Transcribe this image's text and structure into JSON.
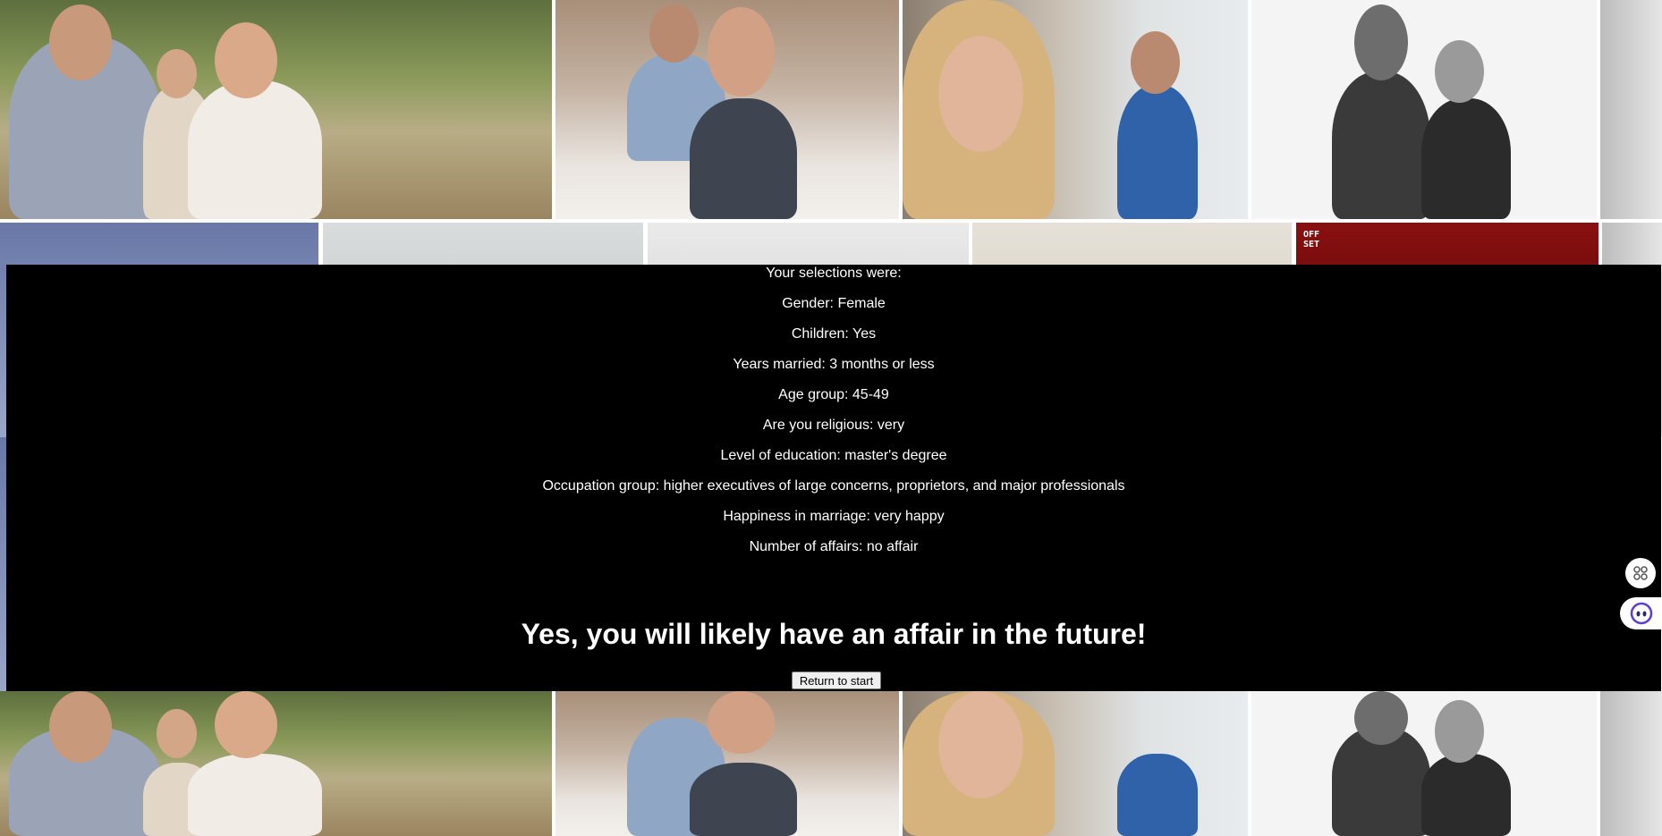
{
  "selections": {
    "heading": "Your selections were:",
    "gender": "Gender: Female",
    "children": "Children: Yes",
    "years_married": "Years married: 3 months or less",
    "age_group": "Age group: 45-49",
    "religious": "Are you religious: very",
    "education": "Level of education: master's degree",
    "occupation": "Occupation group: higher executives of large concerns, proprietors, and major professionals",
    "happiness": "Happiness in marriage: very happy",
    "affairs": "Number of affairs: no affair"
  },
  "result": {
    "verdict": "Yes, you will likely have an affair in the future!"
  },
  "actions": {
    "return_label": "Return to start"
  },
  "background": {
    "logo_text_line1": "OFF",
    "logo_text_line2": "SET"
  },
  "side_widgets": {
    "apps_icon": "apps-grid-icon",
    "assistant_icon": "assistant-eyes-icon"
  }
}
